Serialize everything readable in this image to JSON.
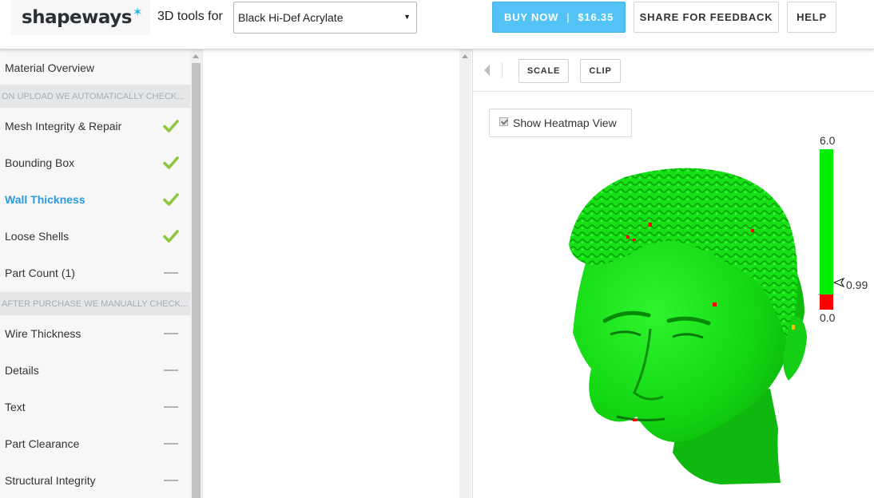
{
  "header": {
    "logo_text": "shapeways",
    "tools_label": "3D tools for",
    "material_select": {
      "selected": "Black Hi-Def Acrylate"
    },
    "buy_button": {
      "label": "BUY NOW",
      "separator": "|",
      "price": "$16.35"
    },
    "share_button": "SHARE FOR FEEDBACK",
    "help_button": "HELP"
  },
  "sidebar": {
    "overview": "Material Overview",
    "upload_section": "ON UPLOAD WE AUTOMATICALLY CHECK...",
    "upload_checks": [
      {
        "label": "Mesh Integrity & Repair",
        "status": "pass"
      },
      {
        "label": "Bounding Box",
        "status": "pass"
      },
      {
        "label": "Wall Thickness",
        "status": "pass",
        "active": true
      },
      {
        "label": "Loose Shells",
        "status": "pass"
      },
      {
        "label": "Part Count (1)",
        "status": "none"
      }
    ],
    "purchase_section": "AFTER PURCHASE WE MANUALLY CHECK...",
    "purchase_checks": [
      {
        "label": "Wire Thickness",
        "status": "none"
      },
      {
        "label": "Details",
        "status": "none"
      },
      {
        "label": "Text",
        "status": "none"
      },
      {
        "label": "Part Clearance",
        "status": "none"
      },
      {
        "label": "Structural Integrity",
        "status": "none"
      }
    ]
  },
  "viewer": {
    "toolbar": {
      "scale": "SCALE",
      "clip": "CLIP"
    },
    "heatmap_toggle": {
      "label": "Show Heatmap View",
      "checked": true
    },
    "heatmap_scale": {
      "max": "6.0",
      "min": "0.0",
      "threshold": "0.99",
      "colors": {
        "ok": "#00ee00",
        "fail": "#ff0000"
      }
    }
  },
  "colors": {
    "accent": "#52c3f4",
    "active_link": "#2b9be0",
    "check_green": "#8cc63f",
    "model_green": "#1ee81e"
  }
}
